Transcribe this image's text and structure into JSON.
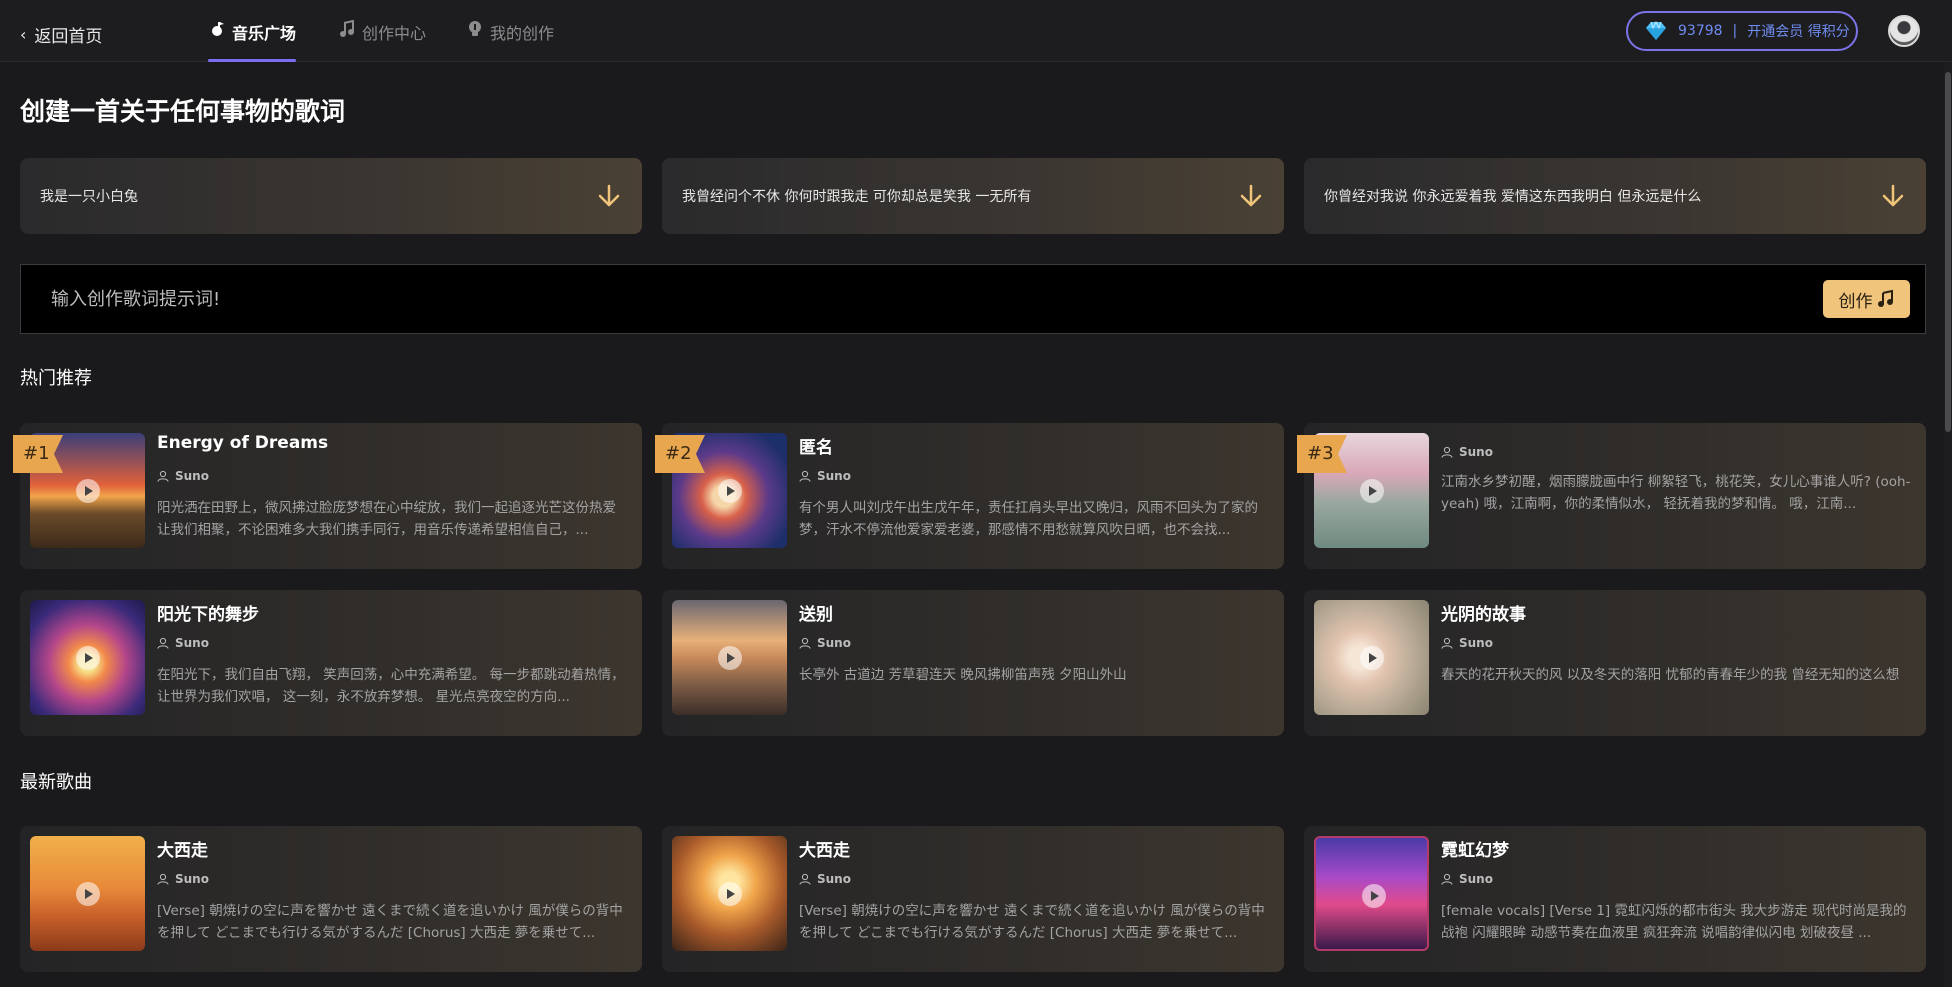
{
  "header": {
    "back_label": "返回首页",
    "tabs": [
      {
        "label": "音乐广场",
        "icon": "music-square-icon",
        "active": true
      },
      {
        "label": "创作中心",
        "icon": "music-note-icon",
        "active": false
      },
      {
        "label": "我的创作",
        "icon": "lightbulb-icon",
        "active": false
      }
    ],
    "points": {
      "value": "93798",
      "separator": "|",
      "action": "开通会员 得积分"
    }
  },
  "main": {
    "title": "创建一首关于任何事物的歌词",
    "prompts": [
      "我是一只小白兔",
      "我曾经问个不休 你何时跟我走 可你却总是笑我 一无所有",
      "你曾经对我说 你永远爱着我 爱情这东西我明白 但永远是什么"
    ],
    "input": {
      "placeholder": "输入创作歌词提示词!"
    },
    "create_button": "创作",
    "hot_title": "热门推荐",
    "latest_title": "最新歌曲"
  },
  "hot_songs": [
    {
      "rank": "#1",
      "title": "Energy of Dreams",
      "author": "Suno",
      "desc": "阳光洒在田野上，微风拂过脸庞梦想在心中绽放，我们一起追逐光芒这份热爱让我们相聚，不论困难多大我们携手同行，用音乐传递希望相信自己，..."
    },
    {
      "rank": "#2",
      "title": "匿名",
      "author": "Suno",
      "desc": "有个男人叫刘戊午出生戊午年，责任扛肩头早出又晚归，风雨不回头为了家的梦，汗水不停流他爱家爱老婆，那感情不用愁就算风吹日晒，也不会找..."
    },
    {
      "rank": "#3",
      "title": "",
      "author": "Suno",
      "desc": "江南水乡梦初醒，烟雨朦胧画中行 柳絮轻飞，桃花笑，女儿心事谁人听? (ooh-yeah) 哦，江南啊，你的柔情似水， 轻抚着我的梦和情。 哦，江南..."
    },
    {
      "rank": "",
      "title": "阳光下的舞步",
      "author": "Suno",
      "desc": "在阳光下，我们自由飞翔， 笑声回荡，心中充满希望。 每一步都跳动着热情， 让世界为我们欢唱， 这一刻，永不放弃梦想。 星光点亮夜空的方向..."
    },
    {
      "rank": "",
      "title": "送别",
      "author": "Suno",
      "desc": "长亭外 古道边 芳草碧连天 晚风拂柳笛声残 夕阳山外山"
    },
    {
      "rank": "",
      "title": "光阴的故事",
      "author": "Suno",
      "desc": "春天的花开秋天的风 以及冬天的落阳 忧郁的青春年少的我 曾经无知的这么想"
    }
  ],
  "latest_songs": [
    {
      "title": "大西走",
      "author": "Suno",
      "desc": "[Verse] 朝焼けの空に声を響かせ 遠くまで続く道を追いかけ 風が僕らの背中を押して どこまでも行ける気がするんだ [Chorus] 大西走 夢を乗せて..."
    },
    {
      "title": "大西走",
      "author": "Suno",
      "desc": "[Verse] 朝焼けの空に声を響かせ 遠くまで続く道を追いかけ 風が僕らの背中を押して どこまでも行ける気がするんだ [Chorus] 大西走 夢を乗せて..."
    },
    {
      "title": "霓虹幻梦",
      "author": "Suno",
      "desc": "[female vocals] [Verse 1] 霓虹闪烁的都市街头 我大步游走 现代时尚是我的战袍 闪耀眼眸 动感节奏在血液里 疯狂奔流 说唱韵律似闪电 划破夜昼 ..."
    }
  ],
  "colors": {
    "accent": "#7c6df0",
    "gold": "#f0c47a",
    "rank": "#e8a64f",
    "points": "#6f8cf0"
  }
}
